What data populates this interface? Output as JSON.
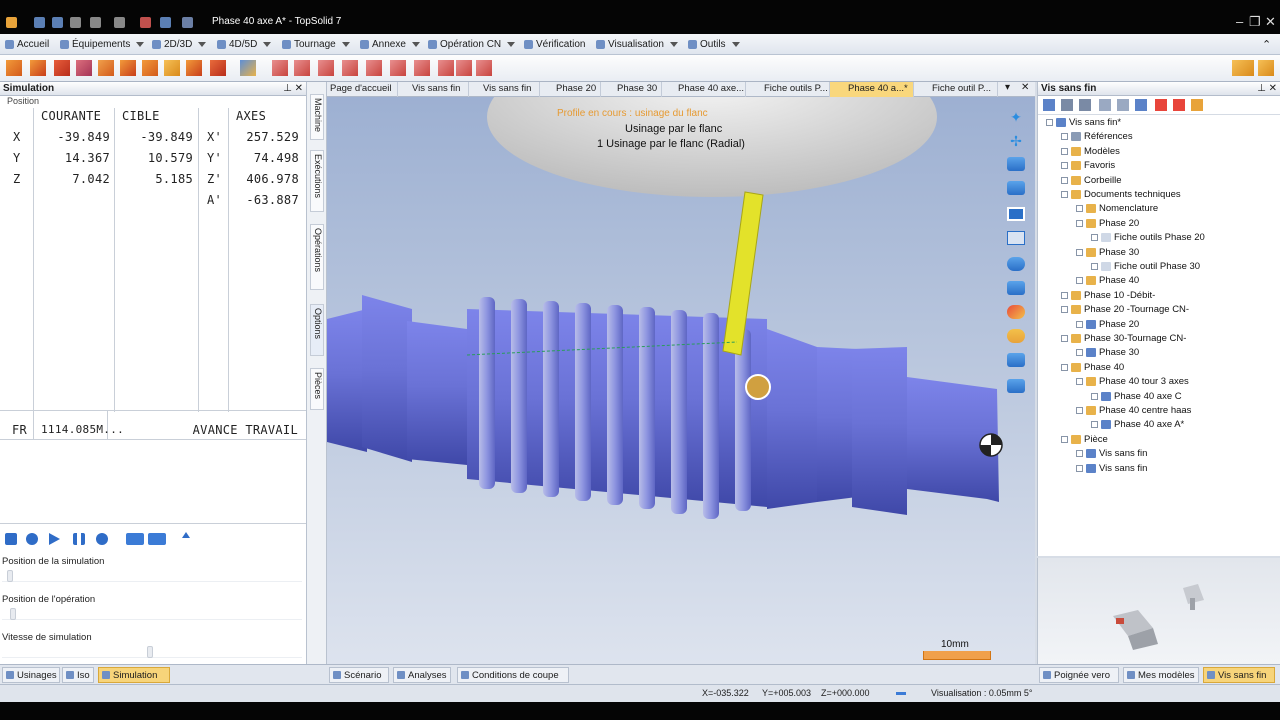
{
  "app": {
    "title": "Phase 40 axe A* - TopSolid 7"
  },
  "ribbon": {
    "tabs": [
      "Accueil",
      "Équipements",
      "2D/3D",
      "4D/5D",
      "Tournage",
      "Annexe",
      "Opération CN",
      "Vérification",
      "Visualisation",
      "Outils"
    ]
  },
  "simulation": {
    "panel_title": "Simulation",
    "section": "Position",
    "headers": {
      "current": "COURANTE",
      "target": "CIBLE",
      "axes": "AXES"
    },
    "rows": [
      {
        "axis": "X",
        "current": "-39.849",
        "target": "-39.849",
        "axis2": "X'",
        "value": "257.529"
      },
      {
        "axis": "Y",
        "current": "14.367",
        "target": "10.579",
        "axis2": "Y'",
        "value": "74.498"
      },
      {
        "axis": "Z",
        "current": "7.042",
        "target": "5.185",
        "axis2": "Z'",
        "value": "406.978"
      },
      {
        "axis": "",
        "current": "",
        "target": "",
        "axis2": "A'",
        "value": "-63.887"
      }
    ],
    "feed": {
      "label": "FR",
      "value": "1114.085M...",
      "mode": "AVANCE TRAVAIL"
    },
    "sliders": {
      "sim_position": "Position de la simulation",
      "op_position": "Position de l'opération",
      "speed": "Vitesse de simulation"
    }
  },
  "side_tabs": [
    "Machine",
    "Exécutions",
    "Opérations",
    "Options",
    "Pièces"
  ],
  "doc_tabs": [
    "Page d'accueil",
    "Vis sans fin",
    "Vis sans fin",
    "Phase 20",
    "Phase 30",
    "Phase 40 axe...",
    "Fiche outils P...",
    "Phase 40 a...*",
    "Fiche outil P..."
  ],
  "viewport": {
    "overlay_orange": "Profile en cours : usinage du flanc",
    "overlay_line1": "Usinage par le flanc",
    "overlay_line2": "1  Usinage par le flanc (Radial)",
    "scale_label": "10mm"
  },
  "tree": {
    "panel_title": "Vis sans fin",
    "nodes": [
      {
        "label": "Vis sans fin*",
        "level": 0,
        "color": "#5b82c8"
      },
      {
        "label": "Références",
        "level": 1,
        "color": "#8a9bb5"
      },
      {
        "label": "Modèles",
        "level": 1,
        "color": "#e8b24a"
      },
      {
        "label": "Favoris",
        "level": 1,
        "color": "#e8b24a"
      },
      {
        "label": "Corbeille",
        "level": 1,
        "color": "#e8b24a"
      },
      {
        "label": "Documents techniques",
        "level": 1,
        "color": "#e8b24a"
      },
      {
        "label": "Nomenclature",
        "level": 2,
        "color": "#e8b24a"
      },
      {
        "label": "Phase 20",
        "level": 2,
        "color": "#e8b24a"
      },
      {
        "label": "Fiche outils Phase 20",
        "level": 3,
        "color": "#cfd8e6"
      },
      {
        "label": "Phase 30",
        "level": 2,
        "color": "#e8b24a"
      },
      {
        "label": "Fiche outil Phase 30",
        "level": 3,
        "color": "#cfd8e6"
      },
      {
        "label": "Phase 40",
        "level": 2,
        "color": "#e8b24a"
      },
      {
        "label": "Phase 10 -Débit-",
        "level": 1,
        "color": "#e8b24a"
      },
      {
        "label": "Phase 20 -Tournage CN-",
        "level": 1,
        "color": "#e8b24a"
      },
      {
        "label": "Phase 20",
        "level": 2,
        "color": "#5b82c8"
      },
      {
        "label": "Phase 30-Tournage CN-",
        "level": 1,
        "color": "#e8b24a"
      },
      {
        "label": "Phase 30",
        "level": 2,
        "color": "#5b82c8"
      },
      {
        "label": "Phase 40",
        "level": 1,
        "color": "#e8b24a"
      },
      {
        "label": "Phase 40  tour 3 axes",
        "level": 2,
        "color": "#e8b24a"
      },
      {
        "label": "Phase 40 axe C",
        "level": 3,
        "color": "#5b82c8"
      },
      {
        "label": "Phase 40 centre haas",
        "level": 2,
        "color": "#e8b24a"
      },
      {
        "label": "Phase 40 axe A*",
        "level": 3,
        "color": "#5b82c8"
      },
      {
        "label": "Pièce",
        "level": 1,
        "color": "#e8b24a"
      },
      {
        "label": "Vis sans fin",
        "level": 2,
        "color": "#5b82c8"
      },
      {
        "label": "Vis sans fin",
        "level": 2,
        "color": "#5b82c8"
      }
    ]
  },
  "bottom_left_tabs": [
    "Usinages",
    "Iso",
    "Simulation"
  ],
  "bottom_mid_tabs": [
    "Scénario",
    "Analyses",
    "Conditions de coupe"
  ],
  "bottom_right_tabs": [
    "Poignée vero",
    "Mes modèles",
    "Vis sans fin"
  ],
  "status": {
    "x": "X=-035.322",
    "y": "Y=+005.003",
    "z": "Z=+000.000",
    "visualisation": "Visualisation : 0.05mm 5°"
  },
  "colors": {
    "active_tab": "#f7d47a",
    "part_blue": "#6a72d6",
    "tool_yellow": "#e3e22a"
  }
}
